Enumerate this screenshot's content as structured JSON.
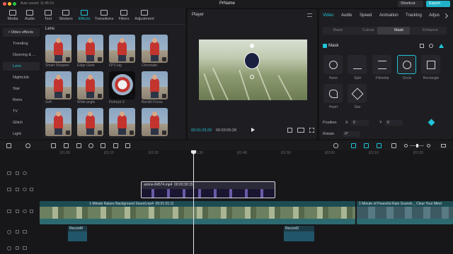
{
  "topbar": {
    "autosave": "Auto saved: 11:45:10",
    "project_name": "PrName",
    "shortcut_label": "Shortcut",
    "export_label": "Export"
  },
  "toolbar": {
    "tabs": [
      {
        "label": "Media"
      },
      {
        "label": "Audio"
      },
      {
        "label": "Text"
      },
      {
        "label": "Stickers"
      },
      {
        "label": "Effects"
      },
      {
        "label": "Transitions"
      },
      {
        "label": "Filters"
      },
      {
        "label": "Adjustment"
      }
    ]
  },
  "effects": {
    "categories": [
      "• Video effects",
      "Trending",
      "Opening & ...",
      "Lens",
      "Nightclub",
      "Star",
      "Retro",
      "TV",
      "Glitch",
      "Light"
    ],
    "section_title": "Lens",
    "items": [
      {
        "label": "Smart Sharpen"
      },
      {
        "label": "Edge Glow"
      },
      {
        "label": "FPS lag"
      },
      {
        "label": "Chromatic"
      },
      {
        "label": "Soft"
      },
      {
        "label": "Wide-angle"
      },
      {
        "label": "Fisheye 3"
      },
      {
        "label": "Backlit Focus"
      },
      {
        "label": ""
      },
      {
        "label": ""
      },
      {
        "label": ""
      },
      {
        "label": ""
      }
    ]
  },
  "player": {
    "title": "Player",
    "current_time": "00:01:29:29",
    "total_time": "00:03:06:28"
  },
  "inspector": {
    "tabs": [
      "Video",
      "Audio",
      "Speed",
      "Animation",
      "Tracking",
      "Adjus"
    ],
    "subtabs": [
      "Basic",
      "Cutout",
      "Mask",
      "Enhance"
    ],
    "mask_title": "Mask",
    "mask_options": [
      "None",
      "Split",
      "Filmstrip",
      "Circle",
      "Rectangle",
      "Heart",
      "Star"
    ],
    "position_label": "Position",
    "position_x_label": "X",
    "position_x": "0",
    "position_y_label": "Y",
    "position_y": "0",
    "rotate_label": "Rotate",
    "rotate_value": "0°"
  },
  "timeline": {
    "ruler": [
      "|01:00",
      "|01:10",
      "|01:20",
      "|01:30",
      "|01:40",
      "|01:50",
      "|02:00",
      "|02:10",
      "|02:20"
    ],
    "clips": {
      "anime": {
        "title": "anime-84574.mp4",
        "duration": "00:00:30:15"
      },
      "main": {
        "title": "1-Minute Nature Background Sound.mp4",
        "duration": "00:01:01:11"
      },
      "rain": {
        "title": "1 Minute of Peaceful Rain Sounds _ Clear Your Mind"
      },
      "record4": {
        "title": "Record4"
      },
      "record3": {
        "title": "Record3"
      }
    }
  },
  "colors": {
    "accent": "#20c3d6",
    "background": "#141416",
    "panel": "#1e1e22"
  }
}
